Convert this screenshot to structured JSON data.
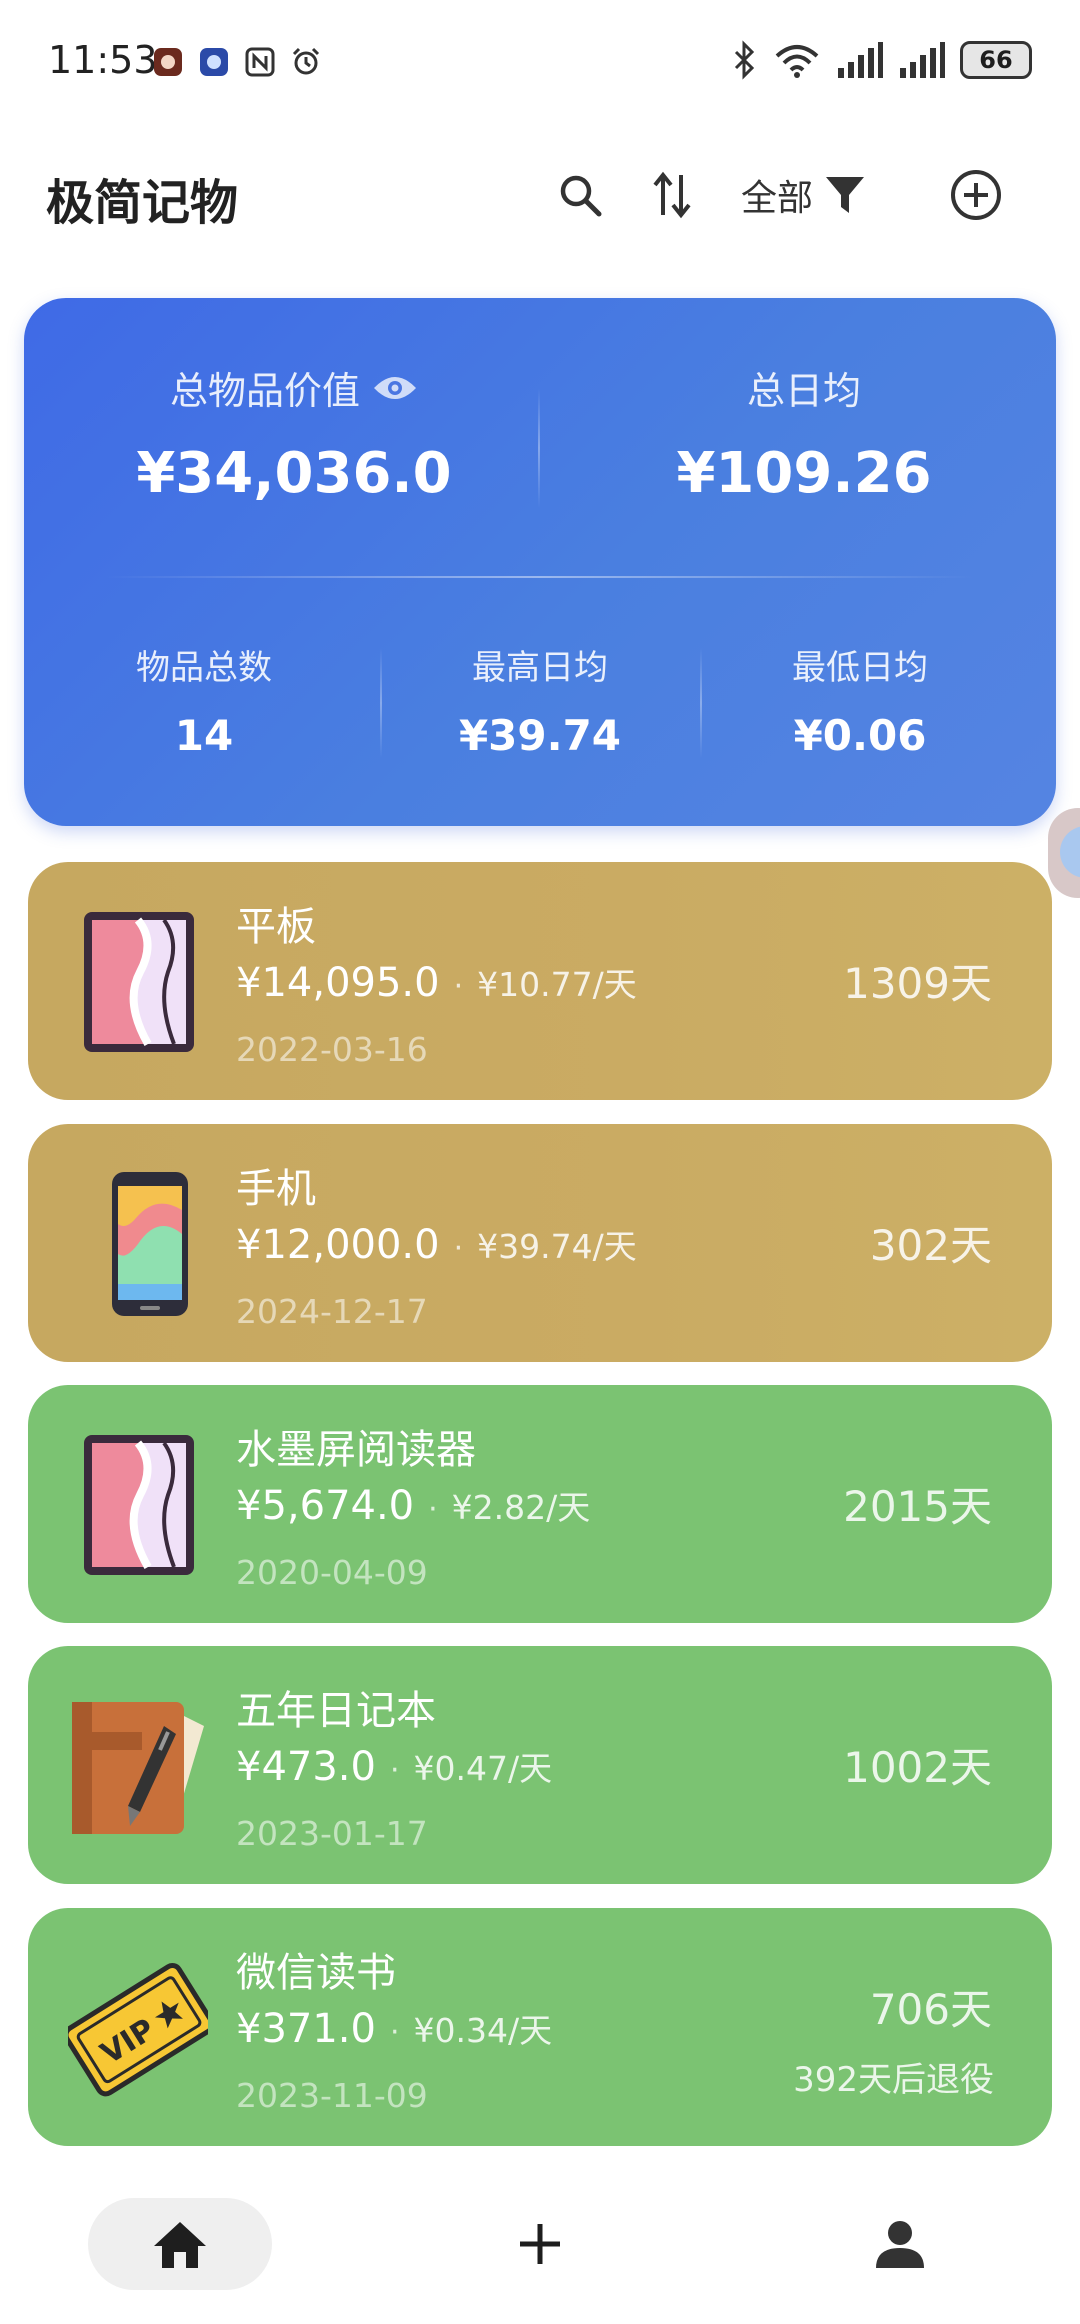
{
  "status_bar": {
    "time": "11:53",
    "battery": "66"
  },
  "header": {
    "title": "极简记物",
    "filter_label": "全部"
  },
  "summary": {
    "total_value_label": "总物品价值",
    "total_value": "¥34,036.0",
    "daily_avg_label": "总日均",
    "daily_avg": "¥109.26",
    "count_label": "物品总数",
    "count": "14",
    "max_daily_label": "最高日均",
    "max_daily": "¥39.74",
    "min_daily_label": "最低日均",
    "min_daily": "¥0.06"
  },
  "items": [
    {
      "name": "平板",
      "price": "¥14,095.0",
      "sep": "·",
      "per_day": "¥10.77/天",
      "date": "2022-03-16",
      "days": "1309天",
      "icon": "tablet-icon",
      "color": "#c8aa62"
    },
    {
      "name": "手机",
      "price": "¥12,000.0",
      "sep": "·",
      "per_day": "¥39.74/天",
      "date": "2024-12-17",
      "days": "302天",
      "icon": "phone-icon",
      "color": "#c8aa62"
    },
    {
      "name": "水墨屏阅读器",
      "price": "¥5,674.0",
      "sep": "·",
      "per_day": "¥2.82/天",
      "date": "2020-04-09",
      "days": "2015天",
      "icon": "tablet-icon",
      "color": "#7bc372"
    },
    {
      "name": "五年日记本",
      "price": "¥473.0",
      "sep": "·",
      "per_day": "¥0.47/天",
      "date": "2023-01-17",
      "days": "1002天",
      "icon": "notebook-icon",
      "color": "#7bc372"
    },
    {
      "name": "微信读书",
      "price": "¥371.0",
      "sep": "·",
      "per_day": "¥0.34/天",
      "date": "2023-11-09",
      "days": "706天",
      "retire": "392天后退役",
      "icon": "vip-ticket-icon",
      "color": "#7bc372"
    }
  ],
  "colors": {
    "summary_blue": "#4472e2",
    "gold": "#c8aa62",
    "green": "#7bc372"
  }
}
